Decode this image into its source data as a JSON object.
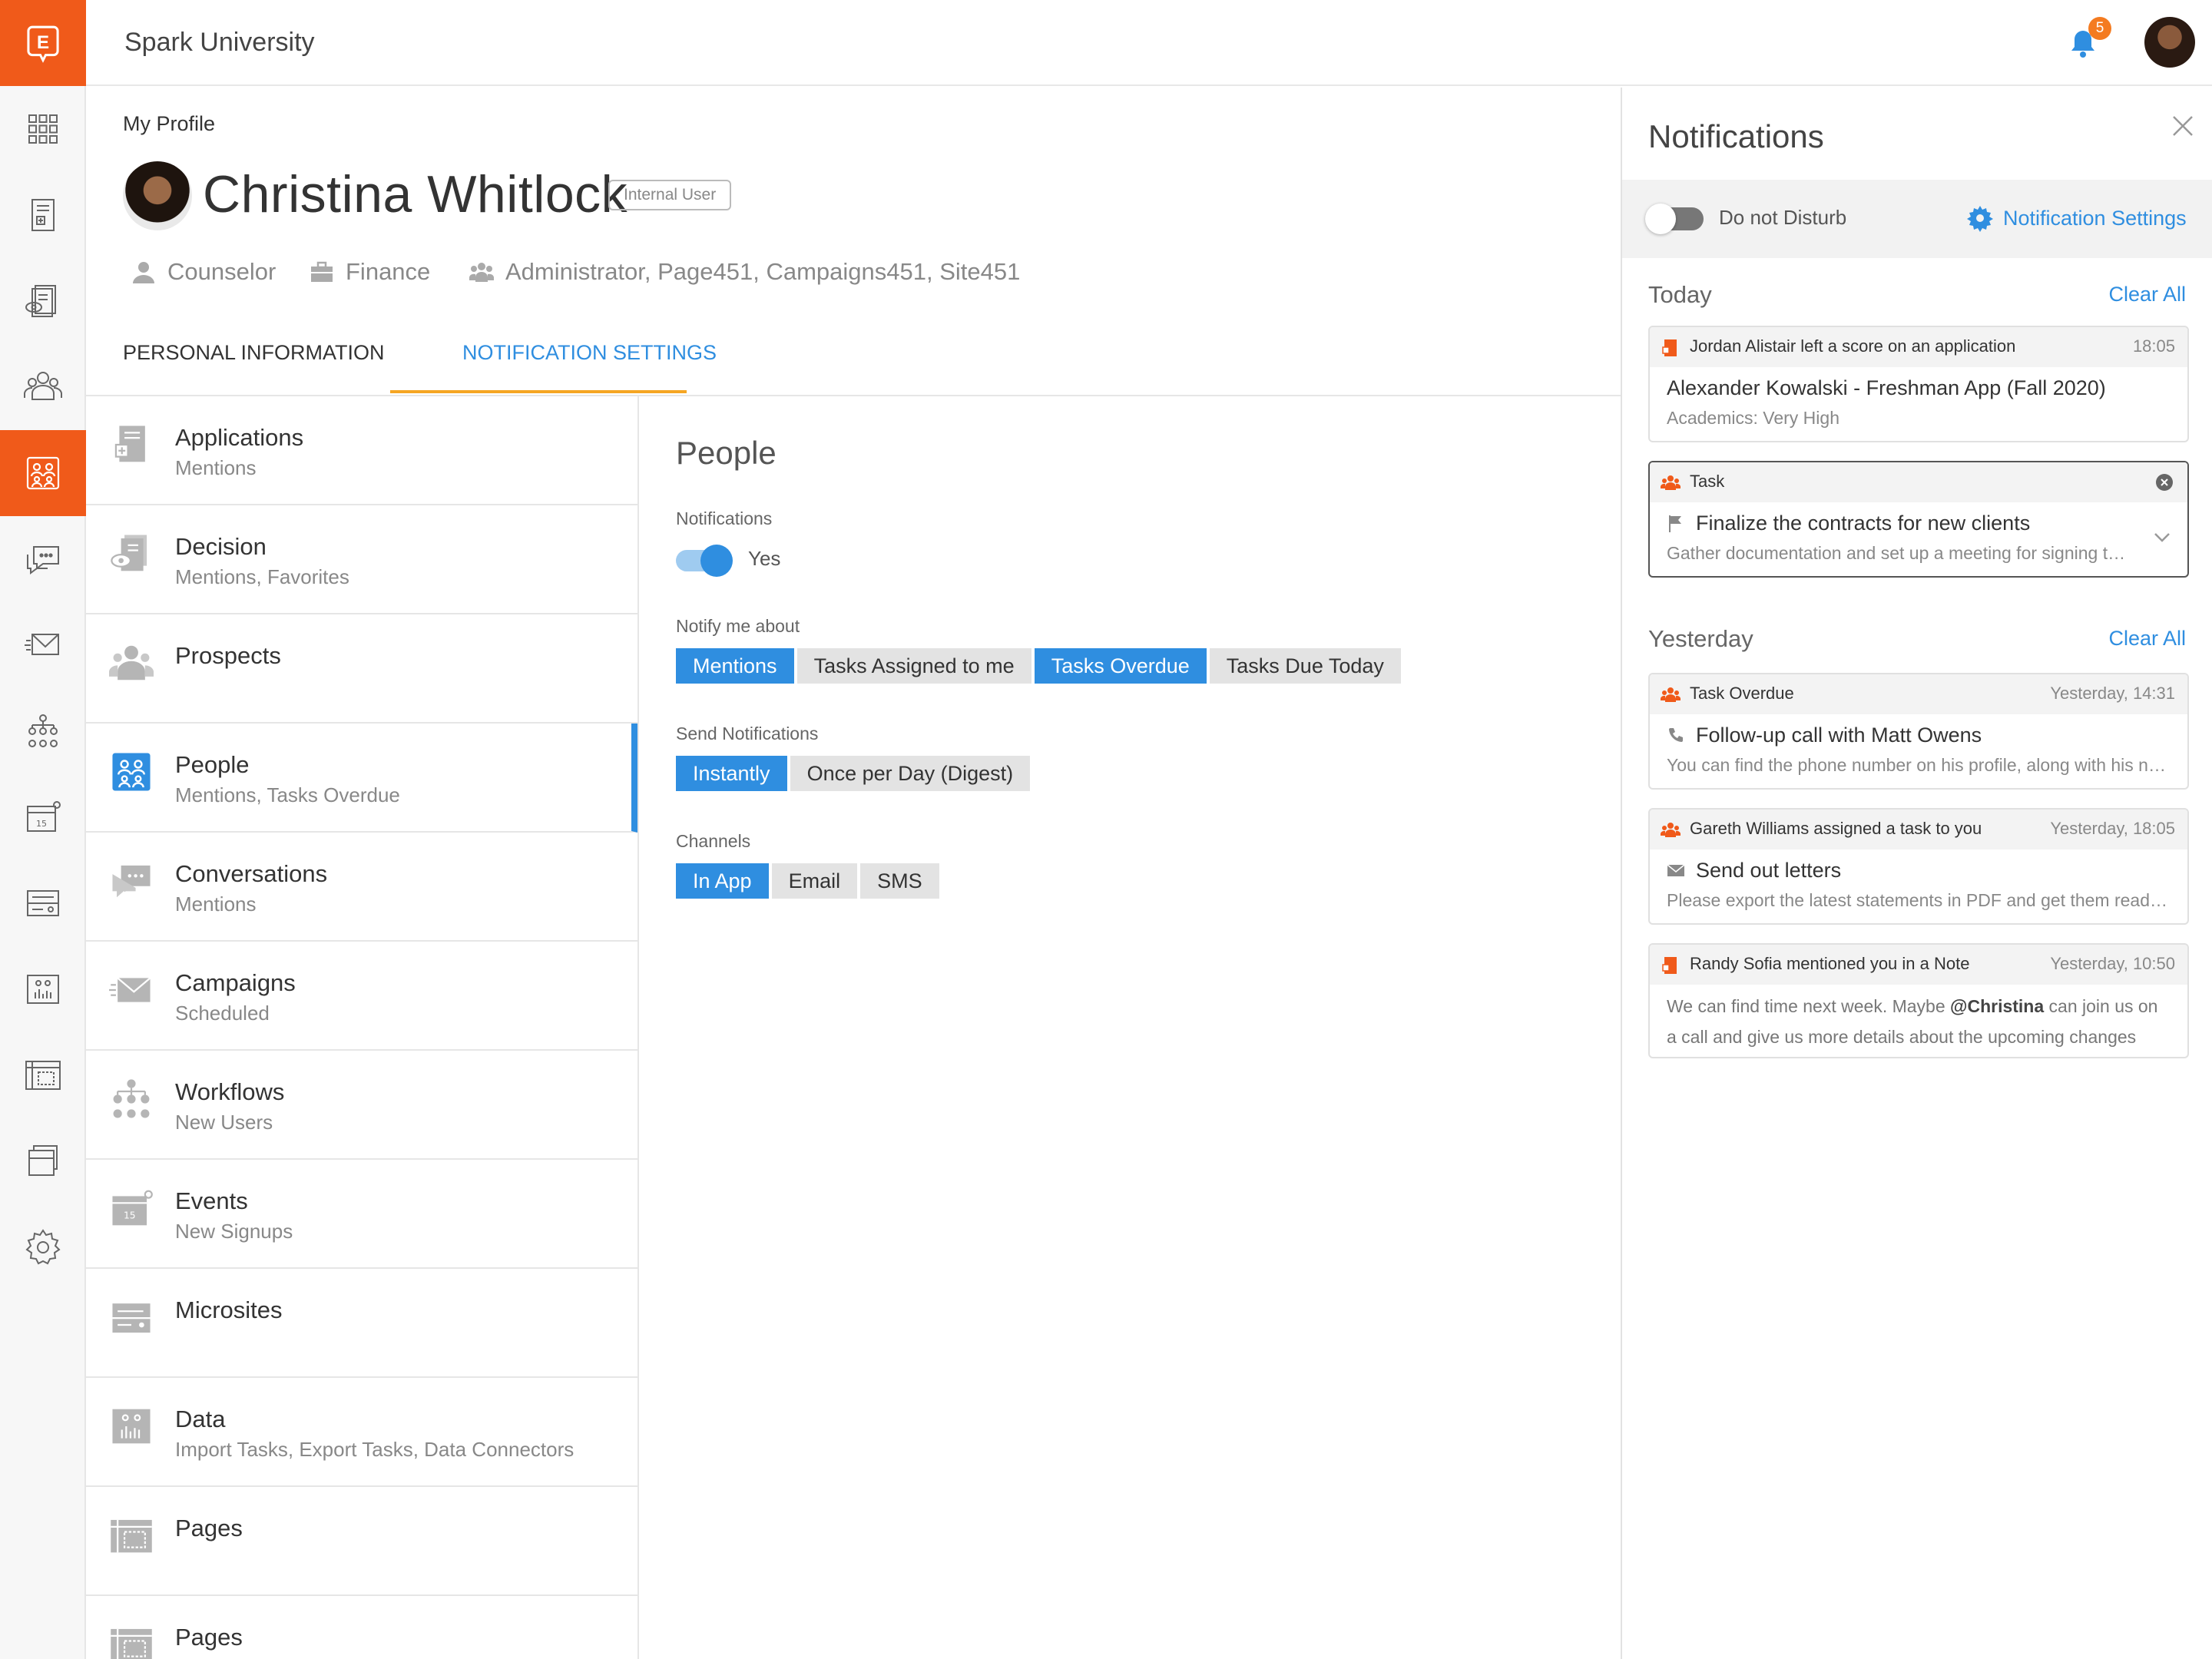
{
  "app": {
    "title": "Spark University",
    "logo_letter": "E",
    "notification_count": "5"
  },
  "colors": {
    "accent_orange": "#f05a1a",
    "accent_blue": "#2f8ee0",
    "tab_underline": "#f5a623"
  },
  "rail": {
    "items": [
      {
        "icon": "grid-icon"
      },
      {
        "icon": "applications-icon"
      },
      {
        "icon": "decision-icon"
      },
      {
        "icon": "prospects-icon"
      },
      {
        "icon": "people-icon",
        "active": true
      },
      {
        "icon": "conversations-icon"
      },
      {
        "icon": "campaigns-icon"
      },
      {
        "icon": "workflows-icon"
      },
      {
        "icon": "events-icon"
      },
      {
        "icon": "microsites-icon"
      },
      {
        "icon": "data-icon"
      },
      {
        "icon": "pages-icon"
      },
      {
        "icon": "documents-icon"
      },
      {
        "icon": "settings-gear-icon"
      }
    ]
  },
  "profile": {
    "breadcrumb": "My Profile",
    "name": "Christina Whitlock",
    "user_type": "Internal User",
    "role": "Counselor",
    "department": "Finance",
    "groups": "Administrator, Page451, Campaigns451, Site451"
  },
  "tabs": [
    {
      "label": "PERSONAL INFORMATION",
      "active": false
    },
    {
      "label": "NOTIFICATION SETTINGS",
      "active": true
    }
  ],
  "categories": [
    {
      "title": "Applications",
      "subtitle": "Mentions",
      "icon": "applications-icon"
    },
    {
      "title": "Decision",
      "subtitle": "Mentions, Favorites",
      "icon": "decision-icon"
    },
    {
      "title": "Prospects",
      "subtitle": "",
      "icon": "prospects-icon"
    },
    {
      "title": "People",
      "subtitle": "Mentions, Tasks Overdue",
      "icon": "people-icon",
      "active": true
    },
    {
      "title": "Conversations",
      "subtitle": "Mentions",
      "icon": "conversations-icon"
    },
    {
      "title": "Campaigns",
      "subtitle": "Scheduled",
      "icon": "campaigns-icon"
    },
    {
      "title": "Workflows",
      "subtitle": "New Users",
      "icon": "workflows-icon"
    },
    {
      "title": "Events",
      "subtitle": "New Signups",
      "icon": "events-icon"
    },
    {
      "title": "Microsites",
      "subtitle": "",
      "icon": "microsites-icon"
    },
    {
      "title": "Data",
      "subtitle": "Import Tasks, Export Tasks, Data Connectors",
      "icon": "data-icon"
    },
    {
      "title": "Pages",
      "subtitle": "",
      "icon": "pages-icon"
    },
    {
      "title": "Pages",
      "subtitle": "",
      "icon": "pages-icon"
    }
  ],
  "settings": {
    "title": "People",
    "notifications_label": "Notifications",
    "notifications_value": "Yes",
    "notify_label": "Notify me about",
    "notify_options": [
      {
        "label": "Mentions",
        "selected": true
      },
      {
        "label": "Tasks Assigned to me",
        "selected": false
      },
      {
        "label": "Tasks Overdue",
        "selected": true
      },
      {
        "label": "Tasks Due Today",
        "selected": false
      }
    ],
    "send_label": "Send Notifications",
    "send_options": [
      {
        "label": "Instantly",
        "selected": true
      },
      {
        "label": "Once per Day (Digest)",
        "selected": false
      }
    ],
    "channels_label": "Channels",
    "channel_options": [
      {
        "label": "In App",
        "selected": true
      },
      {
        "label": "Email",
        "selected": false
      },
      {
        "label": "SMS",
        "selected": false
      }
    ]
  },
  "notifications": {
    "title": "Notifications",
    "dnd_label": "Do not Disturb",
    "settings_link": "Notification Settings",
    "today_label": "Today",
    "yesterday_label": "Yesterday",
    "clear_all": "Clear All",
    "today": [
      {
        "header": "Jordan Alistair left a score on an application",
        "time": "18:05",
        "main": "Alexander Kowalski - Freshman App (Fall 2020)",
        "sub": "Academics: Very High",
        "icon": "application-doc-icon"
      },
      {
        "header": "Task",
        "main": "Finalize the contracts for new clients",
        "sub": "Gather documentation and set up a meeting for signing the documents with the new clients",
        "icon": "people-group-icon",
        "main_icon": "flag-icon"
      }
    ],
    "yesterday": [
      {
        "header": "Task Overdue",
        "time": "Yesterday, 14:31",
        "main": "Follow-up call with Matt Owens",
        "sub": "You can find the phone number on his profile, along with his new address",
        "icon": "people-group-icon",
        "main_icon": "phone-icon"
      },
      {
        "header": "Gareth Williams assigned a task to you",
        "time": "Yesterday, 18:05",
        "main": "Send out letters",
        "sub": "Please export the latest statements in PDF and get them ready for mailing",
        "icon": "people-group-icon",
        "main_icon": "envelope-icon"
      },
      {
        "header": "Randy Sofia mentioned you in a Note",
        "time": "Yesterday, 10:50",
        "note_before": "We can find time next week. Maybe ",
        "note_mention": "@Christina",
        "note_after": " can join us on a call and give us more details about the upcoming changes to...",
        "icon": "application-doc-icon"
      }
    ]
  }
}
